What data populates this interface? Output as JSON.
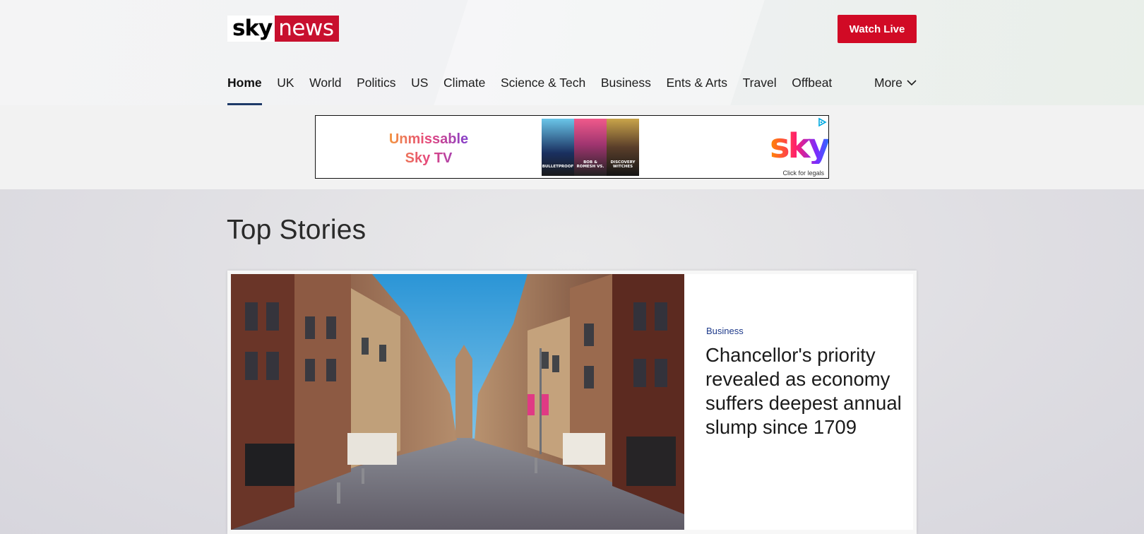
{
  "brand": {
    "logo_sky": "sky",
    "logo_news": "news",
    "accent": "#c8102e"
  },
  "header": {
    "watch_live_label": "Watch Live",
    "nav": [
      "Home",
      "UK",
      "World",
      "Politics",
      "US",
      "Climate",
      "Science & Tech",
      "Business",
      "Ents & Arts",
      "Travel",
      "Offbeat"
    ],
    "active_nav": "Home",
    "more_label": "More",
    "more_icon": "chevron-down-icon"
  },
  "ad": {
    "tagline_line1": "Unmissable",
    "tagline_line2": "Sky TV",
    "poster_titles": [
      "BULLETPROOF",
      "BOB & ROMESH VS.",
      "DISCOVERY WITCHES"
    ],
    "logo": "sky",
    "legal": "Click for legals",
    "adchoices_icon": "adchoices-icon"
  },
  "main": {
    "section_title": "Top Stories",
    "lead_story": {
      "category": "Business",
      "headline": "Chancellor's priority revealed as economy suffers deepest annual slump since 1709",
      "image_icon": "empty-shopping-street-photo"
    }
  }
}
